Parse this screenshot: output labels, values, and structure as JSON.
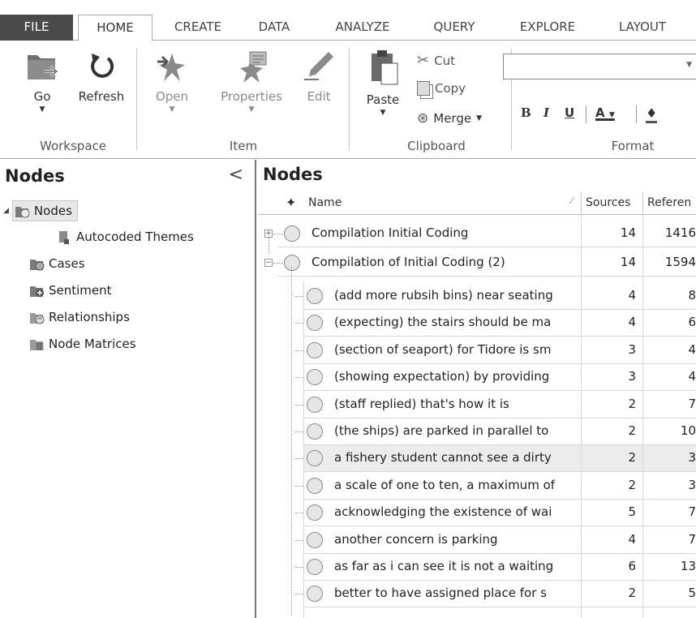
{
  "tabs": [
    "FILE",
    "HOME",
    "CREATE",
    "DATA",
    "ANALYZE",
    "QUERY",
    "EXPLORE",
    "LAYOUT"
  ],
  "ribbon": {
    "workspace": {
      "go": "Go",
      "refresh": "Refresh",
      "label": "Workspace"
    },
    "item": {
      "open": "Open",
      "properties": "Properties",
      "edit": "Edit",
      "label": "Item"
    },
    "clipboard": {
      "paste": "Paste",
      "cut": "Cut",
      "copy": "Copy",
      "merge": "Merge",
      "label": "Clipboard"
    },
    "format": {
      "bold": "B",
      "italic": "I",
      "underline": "U",
      "font_color": "A",
      "label": "Format"
    }
  },
  "nav": {
    "title": "Nodes",
    "collapse": "<",
    "items": [
      {
        "label": "Nodes"
      },
      {
        "label": "Autocoded Themes"
      },
      {
        "label": "Cases"
      },
      {
        "label": "Sentiment"
      },
      {
        "label": "Relationships"
      },
      {
        "label": "Node Matrices"
      }
    ]
  },
  "list": {
    "title": "Nodes",
    "columns": {
      "name": "Name",
      "sources": "Sources",
      "references": "Referen"
    },
    "top_rows": [
      {
        "name": "Compilation Initial Coding",
        "sources": "14",
        "references": "1416",
        "toggle": "+"
      },
      {
        "name": "Compilation of Initial Coding (2)",
        "sources": "14",
        "references": "1594",
        "toggle": "−"
      }
    ],
    "child_rows": [
      {
        "name": "(add more rubsih bins) near seating",
        "sources": "4",
        "references": "8"
      },
      {
        "name": "(expecting) the stairs should be ma",
        "sources": "4",
        "references": "6"
      },
      {
        "name": "(section of seaport) for Tidore is sm",
        "sources": "3",
        "references": "4"
      },
      {
        "name": "(showing expectation) by providing",
        "sources": "3",
        "references": "4"
      },
      {
        "name": "(staff replied) that's how it is",
        "sources": "2",
        "references": "7"
      },
      {
        "name": "(the ships) are parked in parallel to",
        "sources": "2",
        "references": "10"
      },
      {
        "name": "a fishery student cannot see a dirty",
        "sources": "2",
        "references": "3"
      },
      {
        "name": "a scale of one to ten, a maximum of",
        "sources": "2",
        "references": "3"
      },
      {
        "name": "acknowledging the existence of wai",
        "sources": "5",
        "references": "7"
      },
      {
        "name": "another concern is parking",
        "sources": "4",
        "references": "7"
      },
      {
        "name": "as far as i can see it is not a waiting",
        "sources": "6",
        "references": "13"
      },
      {
        "name": "better to have assigned place for s",
        "sources": "2",
        "references": "5"
      }
    ]
  }
}
